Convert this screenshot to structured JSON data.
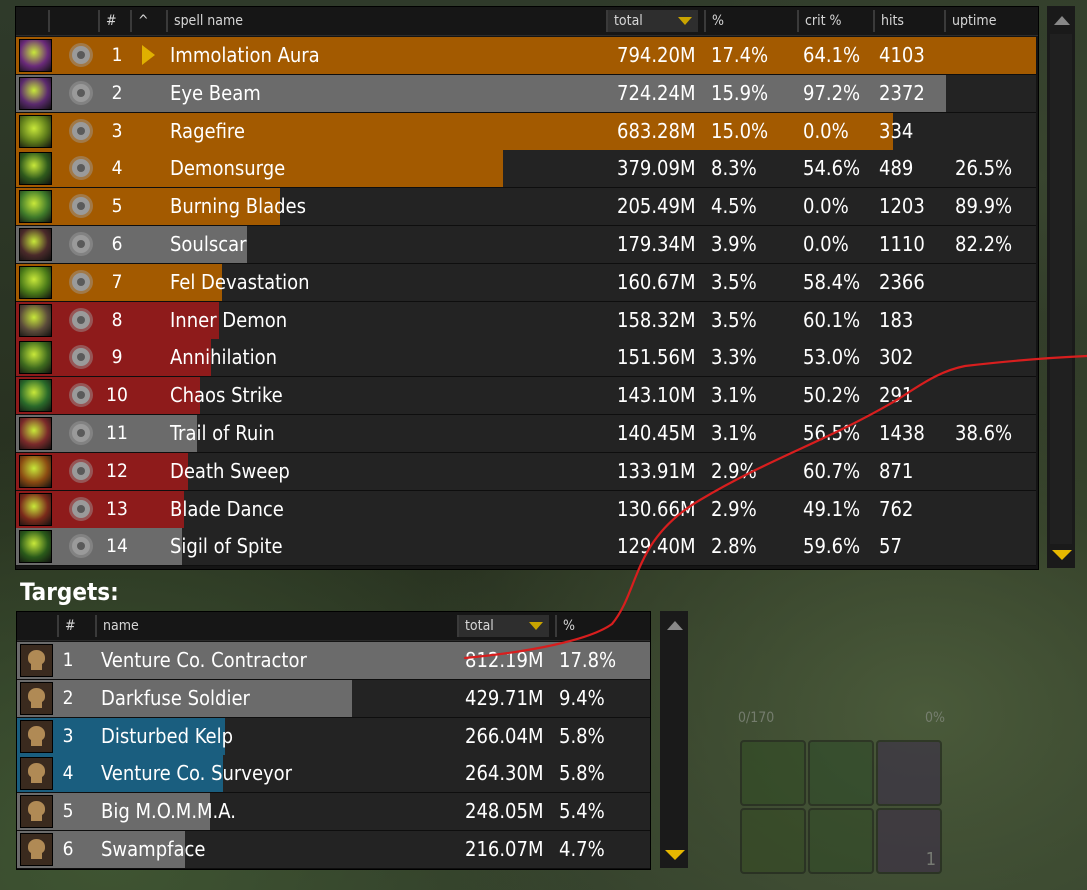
{
  "colors": {
    "orange": "#a35a00",
    "gray": "#6b6b6b",
    "red": "#8e1b1b",
    "blue": "#1a5e7f",
    "accent": "#e6b800",
    "annotation": "#d81e1e"
  },
  "background": {
    "slot_text_left": "0/170",
    "slot_text_right": "0%",
    "slot_count": "1"
  },
  "spells": {
    "headers": {
      "num": "#",
      "sort": "^",
      "name": "spell name",
      "total": "total",
      "pct": "%",
      "crit": "crit %",
      "hits": "hits",
      "uptime": "uptime"
    },
    "rows": [
      {
        "idx": "1",
        "name": "Immolation Aura",
        "total": "794.20M",
        "pct": "17.4%",
        "crit": "64.1%",
        "hits": "4103",
        "uptime": "",
        "bar_fraction": 1.0,
        "bar_color": "orange",
        "icon_color": "#6a2a7a",
        "selected": true
      },
      {
        "idx": "2",
        "name": "Eye Beam",
        "total": "724.24M",
        "pct": "15.9%",
        "crit": "97.2%",
        "hits": "2372",
        "uptime": "",
        "bar_fraction": 0.912,
        "bar_color": "gray",
        "icon_color": "#5b2a6e"
      },
      {
        "idx": "3",
        "name": "Ragefire",
        "total": "683.28M",
        "pct": "15.0%",
        "crit": "0.0%",
        "hits": "334",
        "uptime": "",
        "bar_fraction": 0.86,
        "bar_color": "orange",
        "icon_color": "#5c7a1a"
      },
      {
        "idx": "4",
        "name": "Demonsurge",
        "total": "379.09M",
        "pct": "8.3%",
        "crit": "54.6%",
        "hits": "489",
        "uptime": "26.5%",
        "bar_fraction": 0.477,
        "bar_color": "orange",
        "icon_color": "#2f5a1c"
      },
      {
        "idx": "5",
        "name": "Burning Blades",
        "total": "205.49M",
        "pct": "4.5%",
        "crit": "0.0%",
        "hits": "1203",
        "uptime": "89.9%",
        "bar_fraction": 0.259,
        "bar_color": "orange",
        "icon_color": "#3f7a2a"
      },
      {
        "idx": "6",
        "name": "Soulscar",
        "total": "179.34M",
        "pct": "3.9%",
        "crit": "0.0%",
        "hits": "1110",
        "uptime": "82.2%",
        "bar_fraction": 0.226,
        "bar_color": "gray",
        "icon_color": "#4a2a2a"
      },
      {
        "idx": "7",
        "name": "Fel Devastation",
        "total": "160.67M",
        "pct": "3.5%",
        "crit": "58.4%",
        "hits": "2366",
        "uptime": "",
        "bar_fraction": 0.202,
        "bar_color": "orange",
        "icon_color": "#4a7a18"
      },
      {
        "idx": "8",
        "name": "Inner Demon",
        "total": "158.32M",
        "pct": "3.5%",
        "crit": "60.1%",
        "hits": "183",
        "uptime": "",
        "bar_fraction": 0.199,
        "bar_color": "red",
        "icon_color": "#5a4a3a"
      },
      {
        "idx": "9",
        "name": "Annihilation",
        "total": "151.56M",
        "pct": "3.3%",
        "crit": "53.0%",
        "hits": "302",
        "uptime": "",
        "bar_fraction": 0.191,
        "bar_color": "red",
        "icon_color": "#3e6a1e"
      },
      {
        "idx": "10",
        "name": "Chaos Strike",
        "total": "143.10M",
        "pct": "3.1%",
        "crit": "50.2%",
        "hits": "291",
        "uptime": "",
        "bar_fraction": 0.18,
        "bar_color": "red",
        "icon_color": "#2a6a2a"
      },
      {
        "idx": "11",
        "name": "Trail of Ruin",
        "total": "140.45M",
        "pct": "3.1%",
        "crit": "56.5%",
        "hits": "1438",
        "uptime": "38.6%",
        "bar_fraction": 0.177,
        "bar_color": "gray",
        "icon_color": "#7a2a2a"
      },
      {
        "idx": "12",
        "name": "Death Sweep",
        "total": "133.91M",
        "pct": "2.9%",
        "crit": "60.7%",
        "hits": "871",
        "uptime": "",
        "bar_fraction": 0.169,
        "bar_color": "red",
        "icon_color": "#8a4a12"
      },
      {
        "idx": "13",
        "name": "Blade Dance",
        "total": "130.66M",
        "pct": "2.9%",
        "crit": "49.1%",
        "hits": "762",
        "uptime": "",
        "bar_fraction": 0.165,
        "bar_color": "red",
        "icon_color": "#7a2a1a"
      },
      {
        "idx": "14",
        "name": "Sigil of Spite",
        "total": "129.40M",
        "pct": "2.8%",
        "crit": "59.6%",
        "hits": "57",
        "uptime": "",
        "bar_fraction": 0.163,
        "bar_color": "gray",
        "icon_color": "#2a5a1a"
      }
    ]
  },
  "targets": {
    "label": "Targets:",
    "headers": {
      "num": "#",
      "name": "name",
      "total": "total",
      "pct": "%"
    },
    "rows": [
      {
        "idx": "1",
        "name": "Venture Co. Contractor",
        "total": "812.19M",
        "pct": "17.8%",
        "bar_fraction": 1.0,
        "bar_color": "gray"
      },
      {
        "idx": "2",
        "name": "Darkfuse Soldier",
        "total": "429.71M",
        "pct": "9.4%",
        "bar_fraction": 0.529,
        "bar_color": "gray"
      },
      {
        "idx": "3",
        "name": "Disturbed Kelp",
        "total": "266.04M",
        "pct": "5.8%",
        "bar_fraction": 0.328,
        "bar_color": "blue"
      },
      {
        "idx": "4",
        "name": "Venture Co. Surveyor",
        "total": "264.30M",
        "pct": "5.8%",
        "bar_fraction": 0.325,
        "bar_color": "blue"
      },
      {
        "idx": "5",
        "name": "Big M.O.M.M.A.",
        "total": "248.05M",
        "pct": "5.4%",
        "bar_fraction": 0.305,
        "bar_color": "gray"
      },
      {
        "idx": "6",
        "name": "Swampface",
        "total": "216.07M",
        "pct": "4.7%",
        "bar_fraction": 0.266,
        "bar_color": "gray"
      }
    ]
  }
}
